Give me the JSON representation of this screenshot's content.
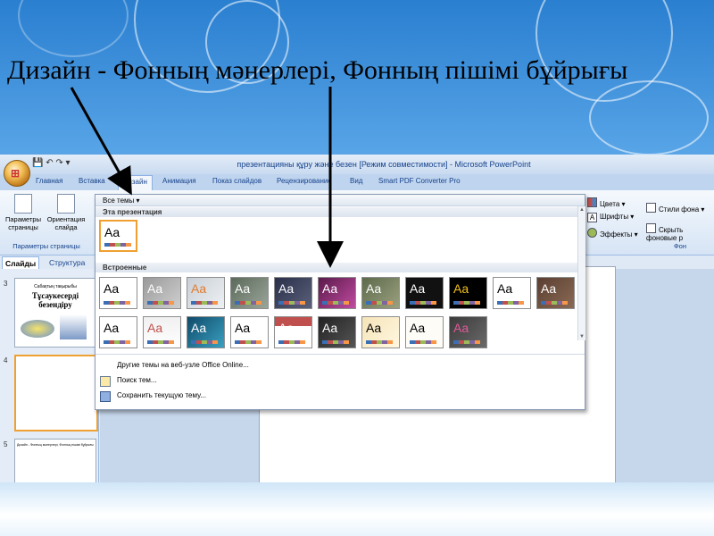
{
  "slide_title": "Дизайн - Фонның мәнерлері, Фонның пішімі бұйрығы",
  "window": {
    "title": "презентацияны құру және безен [Режим совместимости] - Microsoft PowerPoint",
    "office_button_glyph": "⊞"
  },
  "tabs": [
    "Главная",
    "Вставка",
    "Дизайн",
    "Анимация",
    "Показ слайдов",
    "Рецензирование",
    "Вид",
    "Smart PDF Converter Pro"
  ],
  "ribbon": {
    "page_setup_label": "Параметры страницы",
    "orientation_label": "Ориентация слайда",
    "group_page_setup": "Параметры страницы",
    "colors": "Цвета",
    "fonts": "Шрифты",
    "effects": "Эффекты",
    "bg_styles": "Стили фона",
    "hide_bg": "Скрыть фоновые р",
    "group_background": "Фон"
  },
  "panel_tabs": [
    "Слайды",
    "Структура"
  ],
  "thumbnails": {
    "numbers": [
      "3",
      "4",
      "5"
    ],
    "slide3_line1": "Сабақтың тақырыбы",
    "slide3_title": "Тұсаукесерді безендіру",
    "slide5_text": "Дизайн - Фонның мәнерлері, Фонның пішімі бұйрығы"
  },
  "gallery": {
    "header": "Все темы ▾",
    "section_this": "Эта презентация",
    "section_builtin": "Встроенные",
    "theme_text": "Aa",
    "menu": [
      "Другие темы на веб-узле Office Online...",
      "Поиск тем...",
      "Сохранить текущую тему..."
    ]
  },
  "colors": {
    "accent": "#15428b",
    "selected_border": "#f0a030",
    "gallery_bg": "#ffffff"
  }
}
